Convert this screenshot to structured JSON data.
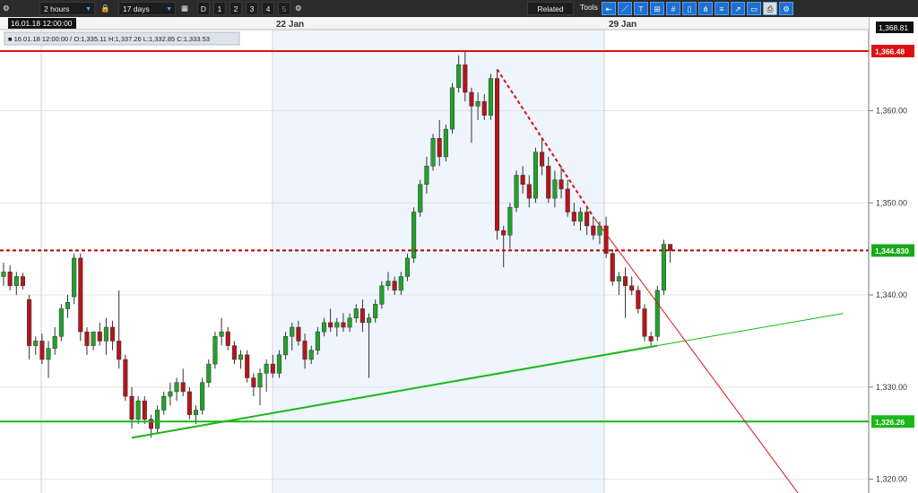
{
  "toolbar": {
    "settings_icon": "gear-icon",
    "interval": "2 hours",
    "lock_icon": "lock-icon",
    "range": "17 days",
    "calendar_icon": "calendar-icon",
    "timeframes": [
      "D",
      "1",
      "2",
      "3",
      "4",
      "5"
    ],
    "related_label": "Related",
    "tools_label": "Tools",
    "tool_icons": [
      "pointer-icon",
      "line-icon",
      "text-icon",
      "grid-icon",
      "hash-icon",
      "candle-icon",
      "pitchfork-icon",
      "fib-icon",
      "arrow-icon",
      "rect-icon",
      "print-icon",
      "settings-tool-icon"
    ]
  },
  "header": {
    "date": "16.01.18 12:00:00",
    "ohlc": "■ 16.01.18 12:00:00 / O:1,335.11  H:1,337.26  L:1,332.85  C:1,333.53",
    "top_price": "1,368.81",
    "date_labels": [
      "22 Jan",
      "29 Jan"
    ]
  },
  "price_tags": {
    "upper_red": "1,366.48",
    "current": "1,344.830",
    "lower_green": "1,326.26"
  },
  "colors": {
    "up": "#23a12c",
    "down": "#b3161c",
    "shade": "#eef5fd",
    "resistance": "#e01010",
    "support": "#18b818"
  },
  "chart_data": {
    "type": "candlestick",
    "title": "",
    "ylim": [
      1318.5,
      1368.81
    ],
    "y_ticks": [
      1320,
      1330,
      1340,
      1350,
      1360
    ],
    "y_tick_labels": [
      "1,320.00",
      "1,330.00",
      "1,340.00",
      "1,350.00",
      "1,360.00"
    ],
    "x_labels": [
      "22 Jan",
      "29 Jan"
    ],
    "grid": true,
    "shaded_period": "22 Jan – 29 Jan",
    "candles": [
      [
        1342.0,
        1343.5,
        1341.0,
        1342.5
      ],
      [
        1342.5,
        1343.2,
        1340.5,
        1341.0
      ],
      [
        1341.0,
        1342.5,
        1340.0,
        1342.0
      ],
      [
        1342.0,
        1342.4,
        1340.6,
        1341.0
      ],
      [
        1339.5,
        1340.0,
        1333.0,
        1334.5
      ],
      [
        1334.5,
        1335.5,
        1333.5,
        1335.0
      ],
      [
        1335.0,
        1335.8,
        1332.5,
        1333.0
      ],
      [
        1333.0,
        1335.0,
        1331.0,
        1334.2
      ],
      [
        1334.2,
        1336.5,
        1333.5,
        1335.5
      ],
      [
        1335.5,
        1339.0,
        1335.0,
        1338.5
      ],
      [
        1338.5,
        1340.0,
        1337.5,
        1339.2
      ],
      [
        1339.8,
        1344.5,
        1339.0,
        1344.0
      ],
      [
        1344.0,
        1344.5,
        1335.0,
        1336.0
      ],
      [
        1336.0,
        1336.5,
        1333.5,
        1334.5
      ],
      [
        1334.5,
        1336.0,
        1334.0,
        1336.0
      ],
      [
        1336.0,
        1337.0,
        1334.5,
        1335.0
      ],
      [
        1335.0,
        1337.5,
        1333.5,
        1336.5
      ],
      [
        1336.5,
        1337.2,
        1334.0,
        1335.0
      ],
      [
        1335.0,
        1340.5,
        1332.0,
        1333.0
      ],
      [
        1333.0,
        1333.5,
        1328.5,
        1329.0
      ],
      [
        1329.0,
        1330.0,
        1325.5,
        1326.5
      ],
      [
        1326.5,
        1329.0,
        1326.0,
        1328.5
      ],
      [
        1328.5,
        1329.0,
        1326.0,
        1326.5
      ],
      [
        1326.5,
        1327.0,
        1324.5,
        1325.5
      ],
      [
        1325.5,
        1328.0,
        1325.0,
        1327.5
      ],
      [
        1327.5,
        1329.5,
        1327.0,
        1329.0
      ],
      [
        1329.0,
        1330.5,
        1328.0,
        1329.5
      ],
      [
        1329.5,
        1331.0,
        1328.5,
        1330.5
      ],
      [
        1330.5,
        1332.0,
        1329.0,
        1329.5
      ],
      [
        1329.5,
        1330.0,
        1326.5,
        1327.0
      ],
      [
        1327.0,
        1328.0,
        1326.0,
        1327.5
      ],
      [
        1327.5,
        1331.0,
        1327.0,
        1330.5
      ],
      [
        1330.5,
        1333.0,
        1330.0,
        1332.5
      ],
      [
        1332.5,
        1336.0,
        1332.0,
        1335.5
      ],
      [
        1335.5,
        1337.5,
        1334.5,
        1336.0
      ],
      [
        1336.0,
        1336.5,
        1334.0,
        1334.5
      ],
      [
        1334.5,
        1335.0,
        1332.5,
        1333.0
      ],
      [
        1333.0,
        1334.0,
        1332.0,
        1333.5
      ],
      [
        1333.5,
        1334.0,
        1330.5,
        1331.0
      ],
      [
        1331.0,
        1331.5,
        1329.0,
        1330.0
      ],
      [
        1330.0,
        1332.0,
        1328.0,
        1331.5
      ],
      [
        1331.5,
        1333.0,
        1329.5,
        1332.5
      ],
      [
        1332.5,
        1333.5,
        1331.0,
        1331.5
      ],
      [
        1331.5,
        1334.0,
        1331.0,
        1333.5
      ],
      [
        1333.5,
        1336.0,
        1333.0,
        1335.5
      ],
      [
        1335.5,
        1337.0,
        1334.0,
        1336.5
      ],
      [
        1336.5,
        1337.2,
        1334.5,
        1335.0
      ],
      [
        1335.0,
        1335.8,
        1332.0,
        1333.0
      ],
      [
        1333.0,
        1334.5,
        1332.5,
        1334.0
      ],
      [
        1334.0,
        1336.5,
        1333.5,
        1336.0
      ],
      [
        1336.0,
        1337.5,
        1335.5,
        1337.0
      ],
      [
        1337.0,
        1338.5,
        1336.0,
        1336.5
      ],
      [
        1336.5,
        1337.5,
        1335.5,
        1337.0
      ],
      [
        1337.0,
        1338.0,
        1336.0,
        1336.5
      ],
      [
        1336.5,
        1338.0,
        1336.0,
        1337.5
      ],
      [
        1337.5,
        1339.0,
        1337.0,
        1338.5
      ],
      [
        1338.5,
        1339.5,
        1336.0,
        1337.0
      ],
      [
        1337.0,
        1338.0,
        1331.0,
        1337.5
      ],
      [
        1337.5,
        1339.5,
        1337.0,
        1339.0
      ],
      [
        1339.0,
        1341.5,
        1338.5,
        1341.0
      ],
      [
        1341.0,
        1342.5,
        1340.5,
        1341.5
      ],
      [
        1341.5,
        1342.0,
        1340.0,
        1340.5
      ],
      [
        1340.5,
        1342.5,
        1340.0,
        1342.0
      ],
      [
        1342.0,
        1344.5,
        1341.5,
        1344.0
      ],
      [
        1344.0,
        1349.5,
        1343.5,
        1349.0
      ],
      [
        1349.0,
        1352.5,
        1348.5,
        1352.0
      ],
      [
        1352.0,
        1355.0,
        1351.0,
        1354.0
      ],
      [
        1354.0,
        1357.5,
        1353.5,
        1357.0
      ],
      [
        1357.0,
        1359.0,
        1354.0,
        1355.0
      ],
      [
        1355.0,
        1358.5,
        1354.5,
        1358.0
      ],
      [
        1358.0,
        1363.0,
        1357.5,
        1362.5
      ],
      [
        1362.5,
        1366.0,
        1362.0,
        1365.0
      ],
      [
        1365.0,
        1366.5,
        1361.0,
        1362.0
      ],
      [
        1362.0,
        1362.5,
        1356.5,
        1360.5
      ],
      [
        1360.5,
        1362.0,
        1359.0,
        1361.0
      ],
      [
        1361.0,
        1361.8,
        1359.0,
        1359.5
      ],
      [
        1359.5,
        1364.0,
        1359.0,
        1363.5
      ],
      [
        1363.5,
        1364.5,
        1346.0,
        1347.0
      ],
      [
        1347.0,
        1347.5,
        1343.0,
        1346.5
      ],
      [
        1346.5,
        1350.0,
        1345.0,
        1349.5
      ],
      [
        1349.5,
        1353.5,
        1349.0,
        1353.0
      ],
      [
        1353.0,
        1354.0,
        1351.0,
        1352.0
      ],
      [
        1352.0,
        1353.0,
        1349.5,
        1350.5
      ],
      [
        1350.5,
        1356.0,
        1350.0,
        1355.5
      ],
      [
        1355.5,
        1357.0,
        1353.0,
        1354.0
      ],
      [
        1354.0,
        1355.0,
        1350.0,
        1350.5
      ],
      [
        1350.5,
        1353.5,
        1349.5,
        1352.5
      ],
      [
        1352.5,
        1354.0,
        1350.5,
        1351.5
      ],
      [
        1351.5,
        1352.5,
        1348.5,
        1349.0
      ],
      [
        1349.0,
        1350.0,
        1347.5,
        1348.0
      ],
      [
        1348.0,
        1349.5,
        1347.0,
        1349.0
      ],
      [
        1349.0,
        1349.5,
        1346.5,
        1347.5
      ],
      [
        1347.5,
        1348.5,
        1346.0,
        1346.5
      ],
      [
        1346.5,
        1348.0,
        1345.5,
        1347.5
      ],
      [
        1347.5,
        1348.5,
        1344.0,
        1344.5
      ],
      [
        1344.5,
        1345.0,
        1341.0,
        1341.5
      ],
      [
        1341.5,
        1342.5,
        1340.0,
        1342.0
      ],
      [
        1342.0,
        1343.0,
        1337.5,
        1341.0
      ],
      [
        1341.0,
        1342.0,
        1340.0,
        1340.5
      ],
      [
        1340.5,
        1341.0,
        1338.0,
        1338.5
      ],
      [
        1338.5,
        1339.0,
        1335.0,
        1335.5
      ],
      [
        1335.5,
        1336.0,
        1334.5,
        1335.0
      ],
      [
        1335.5,
        1341.0,
        1335.0,
        1340.5
      ],
      [
        1340.5,
        1346.0,
        1340.0,
        1345.5
      ],
      [
        1345.5,
        1345.5,
        1343.5,
        1344.83
      ]
    ],
    "lines": [
      {
        "kind": "horizontal",
        "price": 1366.48,
        "style": "solid",
        "color": "red"
      },
      {
        "kind": "horizontal",
        "price": 1344.83,
        "style": "dashed",
        "color": "dark-red"
      },
      {
        "kind": "horizontal",
        "price": 1326.26,
        "style": "solid",
        "color": "green"
      },
      {
        "kind": "trend",
        "from": [
          20,
          1324.5
        ],
        "to": [
          102,
          1334.5
        ],
        "style": "solid",
        "color": "green"
      },
      {
        "kind": "trend",
        "from": [
          102,
          1334.5
        ],
        "to": [
          131,
          1338.0
        ],
        "style": "thin",
        "color": "green"
      },
      {
        "kind": "trend",
        "from": [
          77,
          1364.5
        ],
        "to": [
          92,
          1348.5
        ],
        "style": "dashed",
        "color": "red"
      },
      {
        "kind": "trend",
        "from": [
          92,
          1348.5
        ],
        "to": [
          125,
          1317.5
        ],
        "style": "thin",
        "color": "red"
      }
    ]
  }
}
